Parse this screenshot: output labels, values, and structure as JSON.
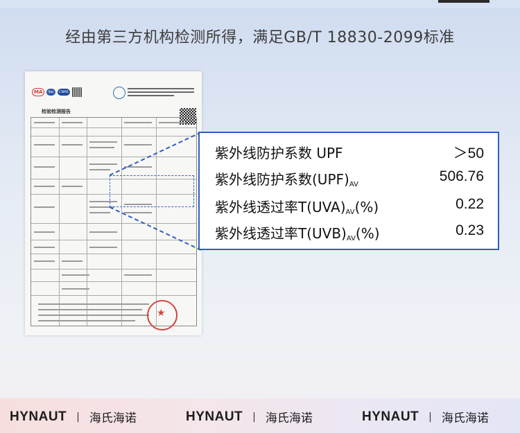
{
  "caption": "经由第三方机构检测所得，满足GB/T 18830-2099标准",
  "report": {
    "title": "检验检测报告",
    "logos": [
      "MA",
      "ilac",
      "CNAS"
    ]
  },
  "callout": {
    "rows": [
      {
        "label": "紫外线防护系数 UPF",
        "sub": "",
        "suffix": "",
        "value": "＞50"
      },
      {
        "label": "紫外线防护系数(UPF)",
        "sub": "AV",
        "suffix": "",
        "value": "506.76"
      },
      {
        "label": "紫外线透过率T(UVA)",
        "sub": "AV",
        "suffix": "(%)",
        "value": "0.22"
      },
      {
        "label": "紫外线透过率T(UVB)",
        "sub": "AV",
        "suffix": "(%)",
        "value": "0.23"
      }
    ]
  },
  "footer": {
    "brands": [
      {
        "en": "HYNAUT",
        "sep": "|",
        "cn": "海氏海诺"
      },
      {
        "en": "HYNAUT",
        "sep": "|",
        "cn": "海氏海诺"
      },
      {
        "en": "HYNAUT",
        "sep": "|",
        "cn": "海氏海诺"
      }
    ]
  },
  "colors": {
    "accent_blue": "#2d5fc1",
    "stamp_red": "#d0463f"
  }
}
